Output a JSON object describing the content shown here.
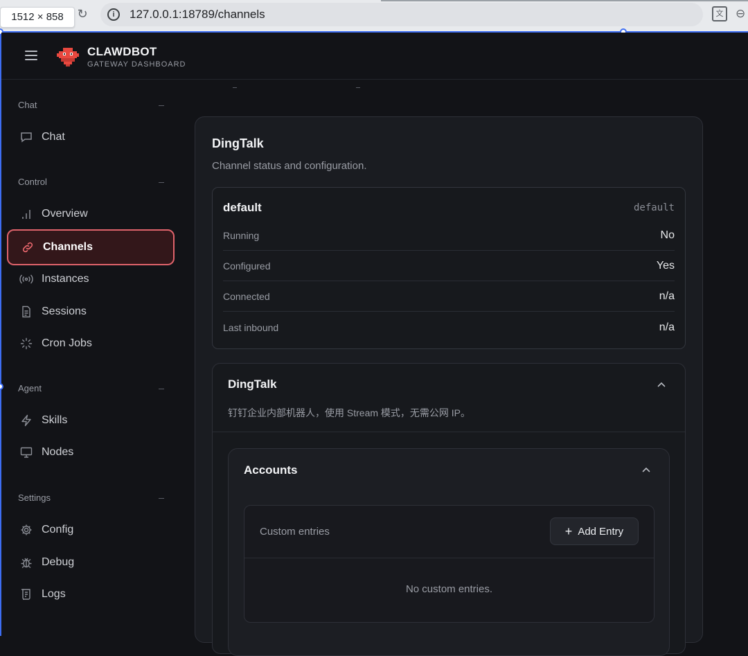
{
  "browser": {
    "size_badge": "1512 × 858",
    "url": "127.0.0.1:18789/channels"
  },
  "app": {
    "brand_name": "CLAWDBOT",
    "brand_sub": "GATEWAY DASHBOARD",
    "accent_color": "#e0636b"
  },
  "sidebar": {
    "groups": [
      {
        "label": "Chat",
        "items": [
          {
            "label": "Chat",
            "icon": "chat-icon"
          }
        ]
      },
      {
        "label": "Control",
        "items": [
          {
            "label": "Overview",
            "icon": "bar-chart-icon"
          },
          {
            "label": "Channels",
            "icon": "link-icon",
            "active": true
          },
          {
            "label": "Instances",
            "icon": "broadcast-icon"
          },
          {
            "label": "Sessions",
            "icon": "document-icon"
          },
          {
            "label": "Cron Jobs",
            "icon": "loader-icon"
          }
        ]
      },
      {
        "label": "Agent",
        "items": [
          {
            "label": "Skills",
            "icon": "lightning-icon"
          },
          {
            "label": "Nodes",
            "icon": "monitor-icon"
          }
        ]
      },
      {
        "label": "Settings",
        "items": [
          {
            "label": "Config",
            "icon": "gear-icon"
          },
          {
            "label": "Debug",
            "icon": "bug-icon"
          },
          {
            "label": "Logs",
            "icon": "scroll-icon"
          }
        ]
      }
    ]
  },
  "channel": {
    "title": "DingTalk",
    "subtitle": "Channel status and configuration.",
    "account": {
      "name": "default",
      "id": "default",
      "rows": [
        {
          "key": "Running",
          "value": "No"
        },
        {
          "key": "Configured",
          "value": "Yes"
        },
        {
          "key": "Connected",
          "value": "n/a"
        },
        {
          "key": "Last inbound",
          "value": "n/a"
        }
      ]
    },
    "plugin": {
      "title": "DingTalk",
      "description": "钉钉企业内部机器人，使用 Stream 模式，无需公网 IP。",
      "accounts": {
        "title": "Accounts",
        "custom_entries_label": "Custom entries",
        "add_entry_label": "Add Entry",
        "empty_text": "No custom entries."
      }
    }
  }
}
